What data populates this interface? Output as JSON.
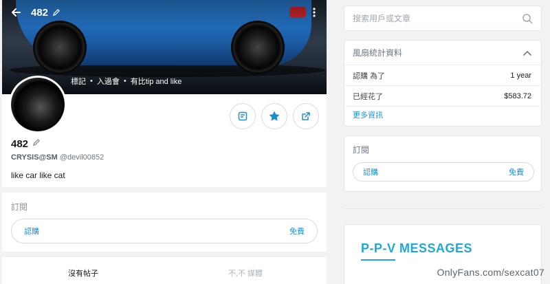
{
  "header": {
    "title": "482"
  },
  "cover": {
    "stats": [
      "標記",
      "入過會",
      "有比tip and like"
    ]
  },
  "profile": {
    "name": "482",
    "display_name": "CRYSIS@SM",
    "handle": "@devil00852",
    "bio": "like car like cat"
  },
  "subscription": {
    "title": "訂閱",
    "button_label": "認購",
    "price": "免費"
  },
  "tabs": [
    {
      "label": "沒有帖子"
    },
    {
      "label": "不,不 媒體"
    }
  ],
  "search": {
    "placeholder": "搜索用戶或文章"
  },
  "fan_stats": {
    "title": "風扇統計資料",
    "rows": [
      {
        "label": "認購 為了",
        "value": "1 year"
      },
      {
        "label": "已經花了",
        "value": "$583.72"
      }
    ],
    "more_label": "更多資訊"
  },
  "right_subscription": {
    "title": "訂閱",
    "button_label": "認購",
    "price": "免費"
  },
  "ppv": {
    "title": "P-P-V  MESSAGES"
  },
  "watermark": "OnlyFans.com/sexcat07",
  "colors": {
    "accent": "#1ea7d8",
    "link": "#1b8fcf"
  }
}
